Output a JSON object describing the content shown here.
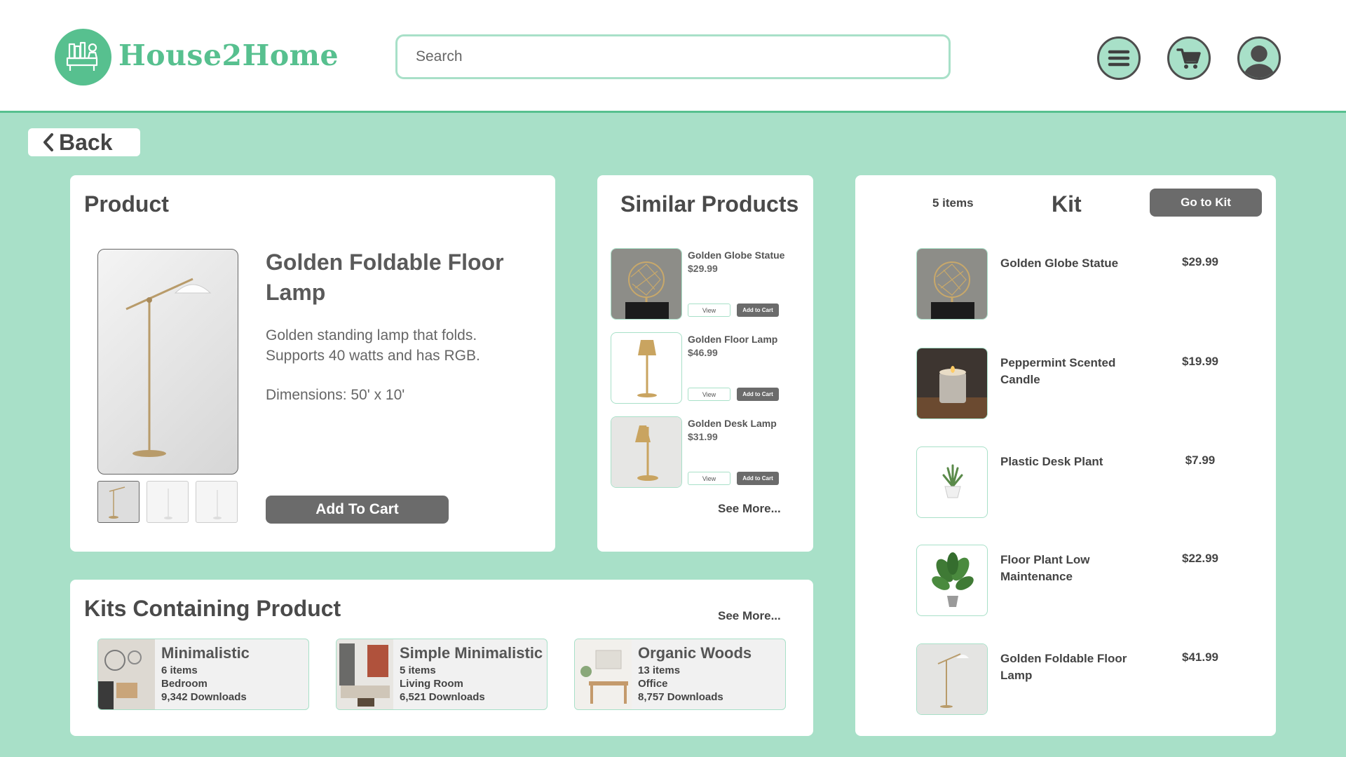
{
  "header": {
    "brand": "House2Home",
    "search_placeholder": "Search",
    "icons": [
      "menu-icon",
      "cart-icon",
      "user-icon"
    ]
  },
  "back_label": "Back",
  "product": {
    "section_title": "Product",
    "name": "Golden Foldable Floor Lamp",
    "description": "Golden standing lamp that folds. Supports 40 watts and has RGB.",
    "dimensions": "Dimensions: 50' x 10'",
    "add_to_cart_label": "Add To  Cart"
  },
  "similar": {
    "section_title": "Similar Products",
    "items": [
      {
        "name": "Golden Globe Statue",
        "price": "$29.99",
        "view_label": "View",
        "add_label": "Add to Cart"
      },
      {
        "name": "Golden Floor Lamp",
        "price": "$46.99",
        "view_label": "View",
        "add_label": "Add to Cart"
      },
      {
        "name": "Golden Desk Lamp",
        "price": "$31.99",
        "view_label": "View",
        "add_label": "Add to Cart"
      }
    ],
    "see_more": "See More..."
  },
  "kits_containing": {
    "section_title": "Kits Containing Product",
    "see_more": "See More...",
    "kits": [
      {
        "name": "Minimalistic",
        "items": "6 items",
        "room": "Bedroom",
        "downloads": "9,342 Downloads"
      },
      {
        "name": "Simple Minimalistic",
        "items": "5 items",
        "room": "Living Room",
        "downloads": "6,521 Downloads"
      },
      {
        "name": "Organic Woods",
        "items": "13 items",
        "room": "Office",
        "downloads": "8,757 Downloads"
      }
    ]
  },
  "kit": {
    "title": "Kit",
    "count": "5 items",
    "goto_label": "Go to Kit",
    "items": [
      {
        "name": "Golden Globe Statue",
        "price": "$29.99"
      },
      {
        "name": "Peppermint Scented Candle",
        "price": "$19.99"
      },
      {
        "name": "Plastic Desk Plant",
        "price": "$7.99"
      },
      {
        "name": "Floor Plant Low Maintenance",
        "price": "$22.99"
      },
      {
        "name": "Golden Foldable Floor Lamp",
        "price": "$41.99"
      }
    ]
  },
  "colors": {
    "brand_green": "#57c08f",
    "mint_background": "#a8e0c8",
    "button_gray": "#6b6b6b"
  }
}
